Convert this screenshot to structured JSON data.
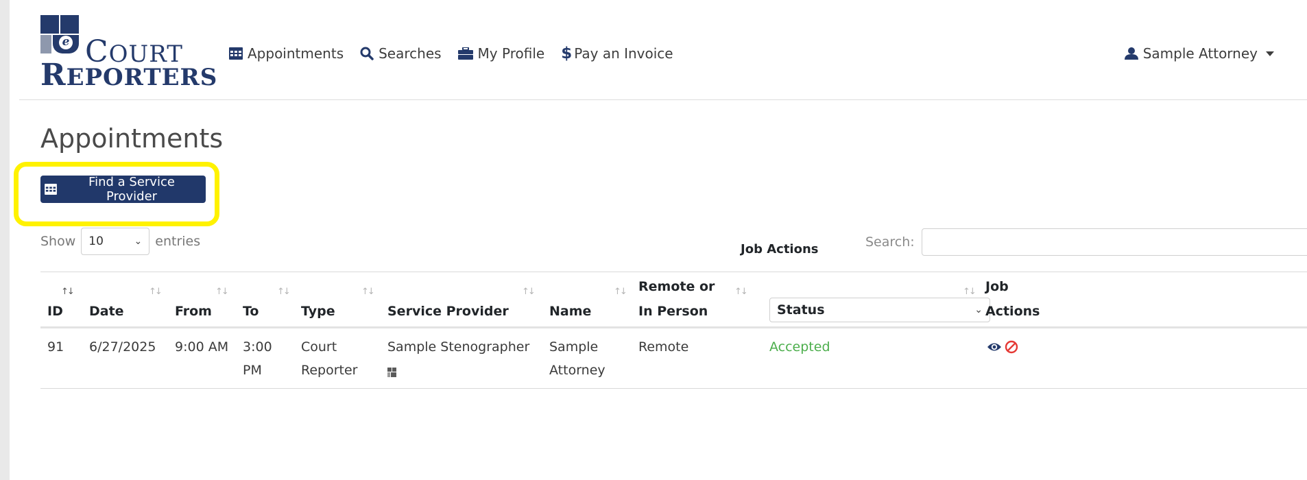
{
  "brand": {
    "logo_letter": "e",
    "logo_line1_big": "C",
    "logo_line1_small": "OURT",
    "logo_line2_big": "R",
    "logo_line2_small": "EPORTERS",
    "color": "#243a6b"
  },
  "nav": {
    "items": [
      {
        "label": "Appointments",
        "icon": "calendar-icon"
      },
      {
        "label": "Searches",
        "icon": "search-icon"
      },
      {
        "label": "My Profile",
        "icon": "briefcase-icon"
      },
      {
        "label": "Pay an Invoice",
        "icon": "dollar-icon",
        "icon_glyph": "$"
      }
    ],
    "user": {
      "label": "Sample Attorney",
      "icon": "user-icon"
    }
  },
  "page": {
    "title": "Appointments",
    "find_button": "Find a Service Provider",
    "highlight_color": "#fff200"
  },
  "controls": {
    "show_label": "Show",
    "entries_value": "10",
    "entries_label": "entries",
    "job_actions_label": "Job Actions",
    "search_label": "Search:",
    "search_value": ""
  },
  "table": {
    "headers": {
      "id": "ID",
      "date": "Date",
      "from": "From",
      "to": "To",
      "type": "Type",
      "service_provider": "Service Provider",
      "name": "Name",
      "remote_line1": "Remote or",
      "remote_line2": "In Person",
      "status": "Status",
      "actions_line1": "Job",
      "actions_line2": "Actions"
    },
    "rows": [
      {
        "id": "91",
        "date": "6/27/2025",
        "from": "9:00 AM",
        "to_line1": "3:00",
        "to_line2": "PM",
        "type_line1": "Court",
        "type_line2": "Reporter",
        "service_provider": "Sample Stenographer",
        "name_line1": "Sample",
        "name_line2": "Attorney",
        "remote": "Remote",
        "status": "Accepted",
        "status_color": "#4cae4c",
        "actions": [
          "eye-icon",
          "ban-icon"
        ]
      }
    ]
  }
}
